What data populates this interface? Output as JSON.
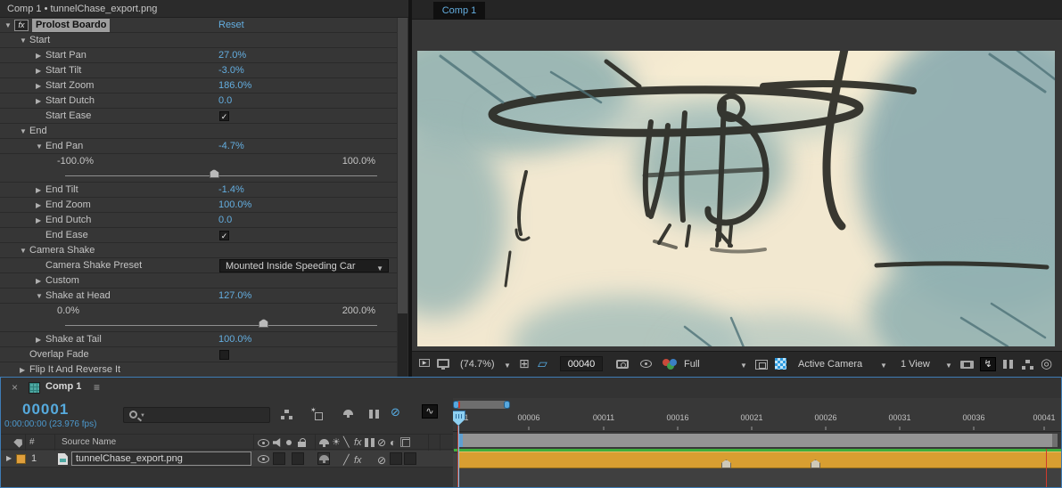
{
  "effect_panel": {
    "header": "Comp 1 • tunnelChase_export.png",
    "effect_name": "Prolost Boardo",
    "reset_label": "Reset",
    "rows": [
      {
        "arrow": "▼",
        "label": "Start"
      },
      {
        "arrow": "▶",
        "label": "Start Pan",
        "value": "27.0%"
      },
      {
        "arrow": "▶",
        "label": "Start Tilt",
        "value": "-3.0%"
      },
      {
        "arrow": "▶",
        "label": "Start Zoom",
        "value": "186.0%"
      },
      {
        "arrow": "▶",
        "label": "Start Dutch",
        "value": "0.0"
      },
      {
        "label": "Start Ease",
        "checked": true
      },
      {
        "arrow": "▼",
        "label": "End"
      },
      {
        "arrow": "▼",
        "label": "End Pan",
        "value": "-4.7%"
      },
      {
        "min": "-100.0%",
        "max": "100.0%",
        "handle_pct": 47.6
      },
      {
        "arrow": "▶",
        "label": "End Tilt",
        "value": "-1.4%"
      },
      {
        "arrow": "▶",
        "label": "End Zoom",
        "value": "100.0%"
      },
      {
        "arrow": "▶",
        "label": "End Dutch",
        "value": "0.0"
      },
      {
        "label": "End Ease",
        "checked": true
      },
      {
        "arrow": "▼",
        "label": "Camera Shake"
      },
      {
        "label": "Camera Shake Preset",
        "value": "Mounted Inside Speeding Car"
      },
      {
        "arrow": "▶",
        "label": "Custom"
      },
      {
        "arrow": "▼",
        "label": "Shake at Head",
        "value": "127.0%"
      },
      {
        "min": "0.0%",
        "max": "200.0%",
        "handle_pct": 63.5
      },
      {
        "arrow": "▶",
        "label": "Shake at Tail",
        "value": "100.0%"
      },
      {
        "label": "Overlap Fade",
        "checked": false
      },
      {
        "arrow": "▶",
        "label": "Flip It And Reverse It"
      }
    ]
  },
  "viewer": {
    "tab": "Comp 1",
    "toolbar": {
      "magnification": "(74.7%)",
      "current_frame": "00040",
      "resolution": "Full",
      "view": "Active Camera",
      "layout": "1 View"
    }
  },
  "timeline": {
    "tab": "Comp 1",
    "current_frame": "00001",
    "timecode": "0:00:00:00 (23.976 fps)",
    "columns": {
      "hash": "#",
      "source_name": "Source Name"
    },
    "layer": {
      "index": "1",
      "name": "tunnelChase_export.png"
    },
    "ruler_labels": [
      "00001",
      "00006",
      "00011",
      "00016",
      "00021",
      "00026",
      "00031",
      "00036",
      "00041"
    ]
  },
  "icons": {
    "check": "✓",
    "close": "×",
    "menu": "≡",
    "caret": "▼",
    "grid": "⊞",
    "mask": "▱",
    "lightning": "↯",
    "graph": "∿",
    "exposure": "◎",
    "quality_best": "╲",
    "quality_draft": "╱",
    "fx": "fx",
    "motion_blur": "⊘",
    "adjustment": "◐",
    "collapse_sun": "☀",
    "expander": "▶"
  },
  "colors": {
    "value_blue": "#64aee0",
    "layer_orange": "#d89e31",
    "cached_green": "#3fae3c",
    "focus_border_blue": "#3e7cb5",
    "active_icon_blue": "#57aee6"
  }
}
